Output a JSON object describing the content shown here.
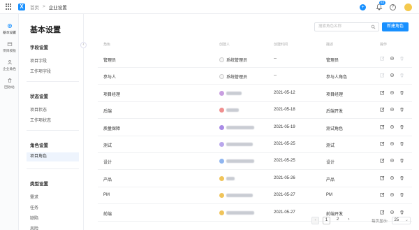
{
  "topbar": {
    "logo_text": "X",
    "breadcrumb": {
      "home": "首页",
      "separator": ">",
      "current": "企业设置"
    },
    "add_icon": "+",
    "notification_badge": "63",
    "help_icon": "?"
  },
  "leftnav": {
    "items": [
      {
        "label": "基本设置",
        "icon": "gear-icon"
      },
      {
        "label": "项目模板",
        "icon": "folder-icon"
      },
      {
        "label": "企业角色",
        "icon": "user-icon"
      },
      {
        "label": "回收站",
        "icon": "trash-icon"
      }
    ]
  },
  "subnav": {
    "title": "基本设置",
    "collapse_icon": "‹",
    "sections": [
      {
        "title": "字段设置",
        "items": [
          "项目字段",
          "工作项字段"
        ]
      },
      {
        "title": "状态设置",
        "items": [
          "项目状态",
          "工作项状态"
        ]
      },
      {
        "title": "角色设置",
        "items": [
          "项目角色"
        ]
      },
      {
        "title": "类型设置",
        "items": [
          "需求",
          "任务",
          "缺陷",
          "风险"
        ]
      }
    ],
    "active_item": "项目角色"
  },
  "search": {
    "placeholder": "搜索角色名称"
  },
  "new_button": {
    "label": "新建角色"
  },
  "table": {
    "headers": [
      "角色",
      "创建人",
      "创建时间",
      "描述",
      "操作"
    ],
    "rows": [
      {
        "role": "管理员",
        "creator": "系统管理员",
        "time": "--",
        "desc": "管理员",
        "system": true
      },
      {
        "role": "参与人",
        "creator": "系统管理员",
        "time": "--",
        "desc": "参与人角色",
        "system": true
      },
      {
        "role": "项目经理",
        "creator": "",
        "time": "2021-05-12",
        "desc": "项目经理",
        "system": false
      },
      {
        "role": "后端",
        "creator": "",
        "time": "2021-05-18",
        "desc": "后端开发",
        "system": false
      },
      {
        "role": "质量保障",
        "creator": "",
        "time": "2021-05-19",
        "desc": "测试角色",
        "system": false
      },
      {
        "role": "测试",
        "creator": "",
        "time": "2021-05-25",
        "desc": "测试",
        "system": false
      },
      {
        "role": "设计",
        "creator": "",
        "time": "2021-05-25",
        "desc": "设计",
        "system": false
      },
      {
        "role": "产品",
        "creator": "",
        "time": "2021-05-26",
        "desc": "产品",
        "system": false
      },
      {
        "role": "PM",
        "creator": "",
        "time": "2021-05-27",
        "desc": "PM",
        "system": false
      },
      {
        "role": "前端",
        "creator": "",
        "time": "2021-05-27",
        "desc": "前端开发",
        "system": false
      }
    ]
  },
  "pagination": {
    "prev": "‹",
    "pages": [
      "1",
      "2"
    ],
    "next": "›",
    "per_page_label": "每页显示:",
    "per_page_value": "25",
    "per_page_caret": "⌄"
  },
  "colors": {
    "accent": "#1890ff",
    "avatar": "#f4c94e"
  }
}
